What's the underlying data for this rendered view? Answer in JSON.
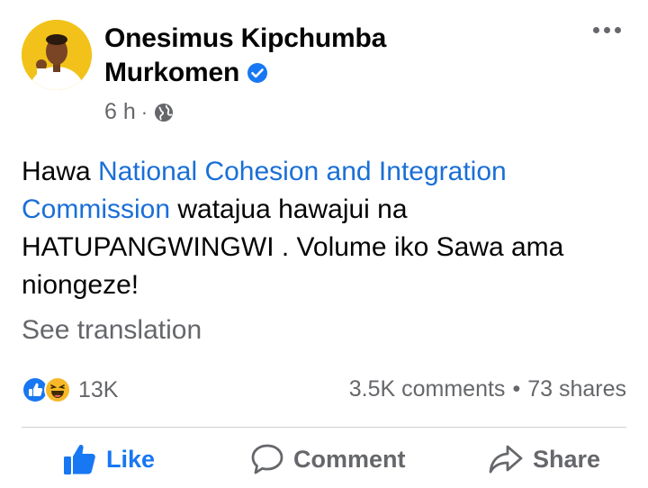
{
  "post": {
    "author_line1": "Onesimus Kipchumba",
    "author_line2": "Murkomen",
    "time": "6 h",
    "meta_separator": "·",
    "text": {
      "prefix": "Hawa ",
      "link": "National Cohesion and Integration Commission",
      "suffix": " watajua hawajui na HATUPANGWINGWI . Volume iko Sawa ama niongeze!"
    },
    "see_translation": "See translation"
  },
  "stats": {
    "reactions_count": "13K",
    "comments": "3.5K comments",
    "separator": "•",
    "shares": "73 shares"
  },
  "actions": {
    "like": "Like",
    "comment": "Comment",
    "share": "Share"
  },
  "icons": {
    "verified": "verified-badge-icon",
    "audience": "globe-icon",
    "more": "more-options-icon",
    "reaction_1": "like-reaction-icon",
    "reaction_2": "haha-reaction-icon"
  },
  "colors": {
    "brand_blue": "#1877f2",
    "link_blue": "#1a6fd6",
    "secondary_text": "#65676b",
    "primary_text": "#050505",
    "haha_yellow": "#f7b928"
  }
}
